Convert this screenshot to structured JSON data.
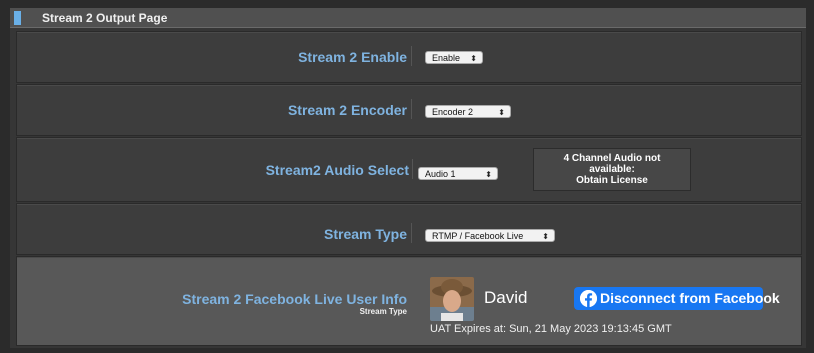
{
  "page": {
    "title": "Stream 2 Output Page"
  },
  "rows": {
    "enable": {
      "label": "Stream 2 Enable",
      "value": "Enable"
    },
    "encoder": {
      "label": "Stream 2 Encoder",
      "value": "Encoder 2"
    },
    "audio": {
      "label": "Stream2 Audio Select",
      "value": "Audio 1",
      "license_notice": [
        "4 Channel Audio not",
        "available:",
        "Obtain License"
      ]
    },
    "type": {
      "label": "Stream Type",
      "value": "RTMP / Facebook Live"
    },
    "facebook": {
      "label": "Stream 2 Facebook Live User Info",
      "sublabel": "Stream Type",
      "user_name": "David",
      "button_label": "Disconnect from Facebook",
      "expires": "UAT Expires at: Sun, 21 May 2023 19:13:45 GMT"
    }
  },
  "colors": {
    "label": "#7fb3e0",
    "facebook_blue": "#1877f2",
    "header_marker": "#6ab0e8"
  },
  "icons": {
    "select_arrows": "updown-chevron-icon",
    "facebook": "facebook-icon",
    "avatar": "user-avatar"
  }
}
